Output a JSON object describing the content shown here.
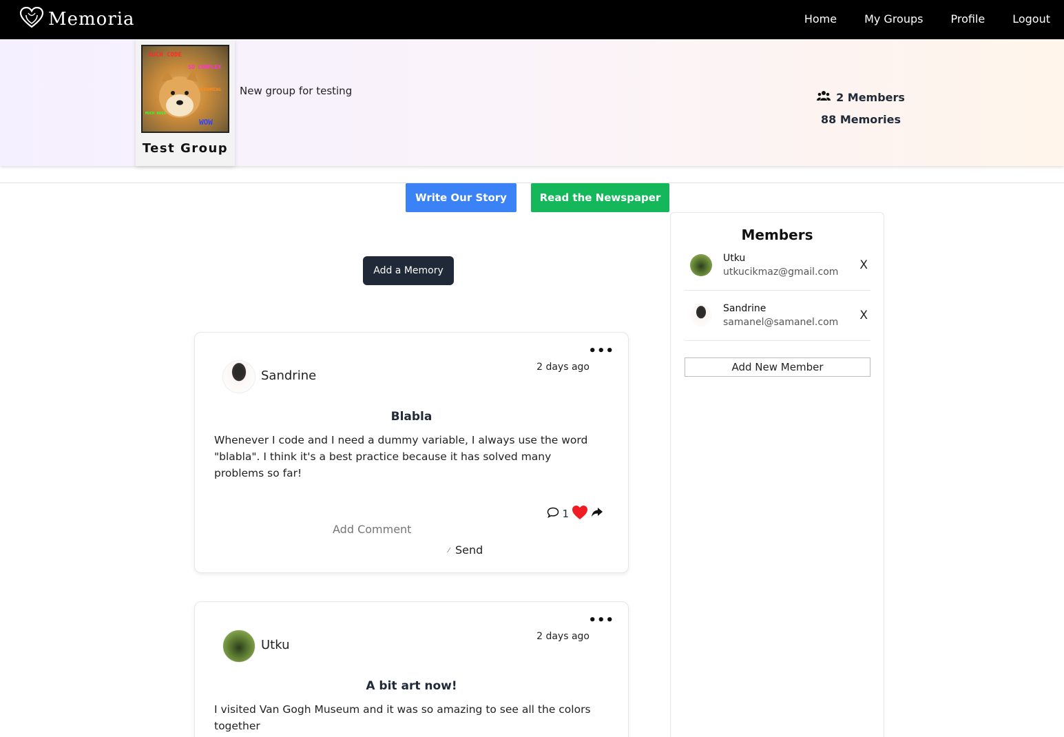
{
  "nav": {
    "brand": "Memoria",
    "links": [
      "Home",
      "My Groups",
      "Profile",
      "Logout"
    ]
  },
  "group": {
    "name": "Test Group",
    "description": "New group for testing",
    "members_count": "2 Members",
    "memories_count": "88 Memories",
    "image_captions": [
      "SUCH CODE",
      "SO COMPLEX",
      "VERY PROGRAMMING",
      "MUCH BUGS SUCH HATE",
      "WOW"
    ]
  },
  "actions": {
    "write_story": "Write Our Story",
    "read_newspaper": "Read the Newspaper",
    "add_memory": "Add a Memory"
  },
  "memories": [
    {
      "author": "Sandrine",
      "time": "2 days ago",
      "title": "Blabla",
      "body": "Whenever I code and I need a dummy variable, I always use the word \"blabla\". I think it's a best practice because it has solved many problems so far!",
      "comment_count": "1",
      "comment_placeholder": "Add Comment",
      "send_label": "Send"
    },
    {
      "author": "Utku",
      "time": "2 days ago",
      "title": "A bit art now!",
      "body": "I visited Van Gogh Museum and it was so amazing to see all the colors together"
    }
  ],
  "members": {
    "title": "Members",
    "list": [
      {
        "name": "Utku",
        "email": "utkucikmaz@gmail.com",
        "remove": "X"
      },
      {
        "name": "Sandrine",
        "email": "samanel@samanel.com",
        "remove": "X"
      }
    ],
    "add_button": "Add New Member"
  },
  "colors": {
    "nav_bg": "#000000",
    "story_button": "#3b82f6",
    "newspaper_button": "#14b85a",
    "add_memory_button": "#1f2937",
    "heart": "#ef1c24"
  }
}
